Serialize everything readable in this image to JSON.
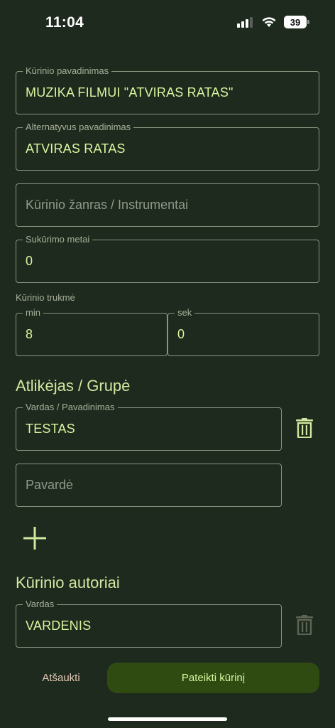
{
  "status_bar": {
    "time": "11:04",
    "battery": "39"
  },
  "form": {
    "title_field": {
      "label": "Kūrinio pavadinimas",
      "value": "MUZIKA FILMUI \"ATVIRAS RATAS\""
    },
    "alt_title_field": {
      "label": "Alternatyvus pavadinimas",
      "value": "ATVIRAS RATAS"
    },
    "genre_field": {
      "placeholder": "Kūrinio žanras / Instrumentai"
    },
    "year_field": {
      "label": "Sukūrimo metai",
      "value": "0"
    },
    "duration": {
      "label": "Kūrinio trukmė",
      "minutes": {
        "label": "min",
        "value": "8"
      },
      "seconds": {
        "label": "sek",
        "value": "0"
      }
    }
  },
  "performer_section": {
    "title": "Atlikėjas / Grupė",
    "name_field": {
      "label": "Vardas / Pavadinimas",
      "value": "TESTAS"
    },
    "surname_field": {
      "placeholder": "Pavardė"
    }
  },
  "authors_section": {
    "title": "Kūrinio autoriai",
    "name_field": {
      "label": "Vardas",
      "value": "VARDENIS"
    }
  },
  "actions": {
    "cancel_label": "Atšaukti",
    "submit_label": "Pateikti kūrinį"
  },
  "colors": {
    "background": "#1f2a1e",
    "accent_text": "#d8f5a0",
    "submit_background": "#2f4b12",
    "cancel_text": "#e0c7b4"
  }
}
